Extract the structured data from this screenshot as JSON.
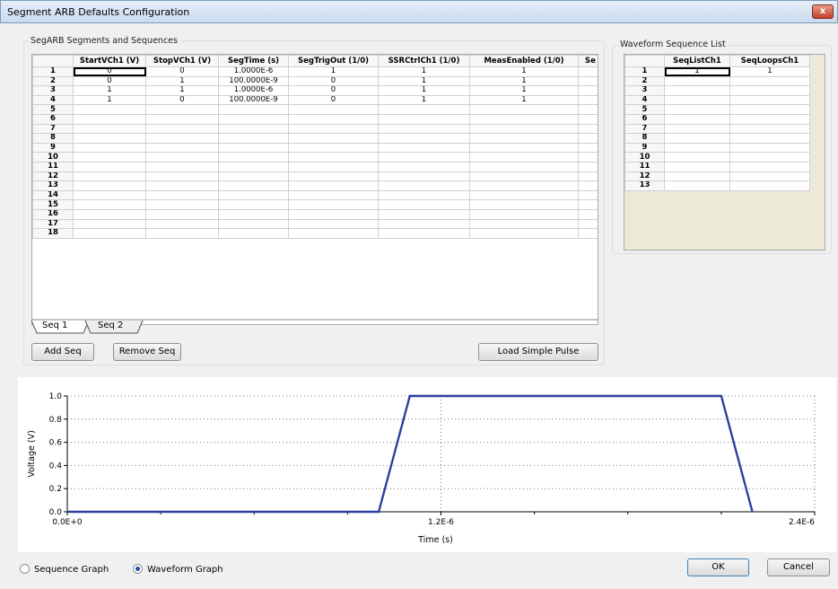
{
  "window": {
    "title": "Segment ARB Defaults Configuration",
    "close_glyph": "x"
  },
  "segments_group": {
    "title": "SegARB Segments and Sequences",
    "columns": [
      "",
      "StartVCh1 (V)",
      "StopVCh1 (V)",
      "SegTime (s)",
      "SegTrigOut (1/0)",
      "SSRCtrlCh1 (1/0)",
      "MeasEnabled (1/0)",
      "Se"
    ],
    "rows": [
      [
        "1",
        "0",
        "0",
        "1.0000E-6",
        "1",
        "1",
        "1",
        ""
      ],
      [
        "2",
        "0",
        "1",
        "100.0000E-9",
        "0",
        "1",
        "1",
        ""
      ],
      [
        "3",
        "1",
        "1",
        "1.0000E-6",
        "0",
        "1",
        "1",
        ""
      ],
      [
        "4",
        "1",
        "0",
        "100.0000E-9",
        "0",
        "1",
        "1",
        ""
      ],
      [
        "5",
        "",
        "",
        "",
        "",
        "",
        "",
        ""
      ],
      [
        "6",
        "",
        "",
        "",
        "",
        "",
        "",
        ""
      ],
      [
        "7",
        "",
        "",
        "",
        "",
        "",
        "",
        ""
      ],
      [
        "8",
        "",
        "",
        "",
        "",
        "",
        "",
        ""
      ],
      [
        "9",
        "",
        "",
        "",
        "",
        "",
        "",
        ""
      ],
      [
        "10",
        "",
        "",
        "",
        "",
        "",
        "",
        ""
      ],
      [
        "11",
        "",
        "",
        "",
        "",
        "",
        "",
        ""
      ],
      [
        "12",
        "",
        "",
        "",
        "",
        "",
        "",
        ""
      ],
      [
        "13",
        "",
        "",
        "",
        "",
        "",
        "",
        ""
      ],
      [
        "14",
        "",
        "",
        "",
        "",
        "",
        "",
        ""
      ],
      [
        "15",
        "",
        "",
        "",
        "",
        "",
        "",
        ""
      ],
      [
        "16",
        "",
        "",
        "",
        "",
        "",
        "",
        ""
      ],
      [
        "17",
        "",
        "",
        "",
        "",
        "",
        "",
        ""
      ],
      [
        "18",
        "",
        "",
        "",
        "",
        "",
        "",
        ""
      ]
    ],
    "tabs": [
      "Seq 1",
      "Seq 2"
    ],
    "buttons": {
      "add": "Add Seq",
      "remove": "Remove Seq",
      "load": "Load Simple Pulse"
    }
  },
  "sequence_group": {
    "title": "Waveform Sequence List",
    "columns": [
      "",
      "SeqListCh1",
      "SeqLoopsCh1"
    ],
    "rows": [
      [
        "1",
        "1",
        "1"
      ],
      [
        "2",
        "",
        ""
      ],
      [
        "3",
        "",
        ""
      ],
      [
        "4",
        "",
        ""
      ],
      [
        "5",
        "",
        ""
      ],
      [
        "6",
        "",
        ""
      ],
      [
        "7",
        "",
        ""
      ],
      [
        "8",
        "",
        ""
      ],
      [
        "9",
        "",
        ""
      ],
      [
        "10",
        "",
        ""
      ],
      [
        "11",
        "",
        ""
      ],
      [
        "12",
        "",
        ""
      ],
      [
        "13",
        "",
        ""
      ]
    ]
  },
  "chart_data": {
    "type": "line",
    "title": "",
    "xlabel": "Time (s)",
    "ylabel": "Voltage (V)",
    "xlim": [
      0,
      2.4e-06
    ],
    "ylim": [
      0,
      1.0
    ],
    "x_tick_labels": [
      "0.0E+0",
      "1.2E-6",
      "2.4E-6"
    ],
    "y_tick_labels": [
      "0.0",
      "0.2",
      "0.4",
      "0.6",
      "0.8",
      "1.0"
    ],
    "grid": true,
    "series": [
      {
        "color": "#2e3f9e",
        "x": [
          0,
          1e-06,
          1.1e-06,
          2.1e-06,
          2.2e-06
        ],
        "y": [
          0,
          0,
          1,
          1,
          0
        ]
      }
    ]
  },
  "footer": {
    "radio_sequence": "Sequence Graph",
    "radio_waveform": "Waveform Graph",
    "selected": "waveform",
    "ok": "OK",
    "cancel": "Cancel"
  }
}
